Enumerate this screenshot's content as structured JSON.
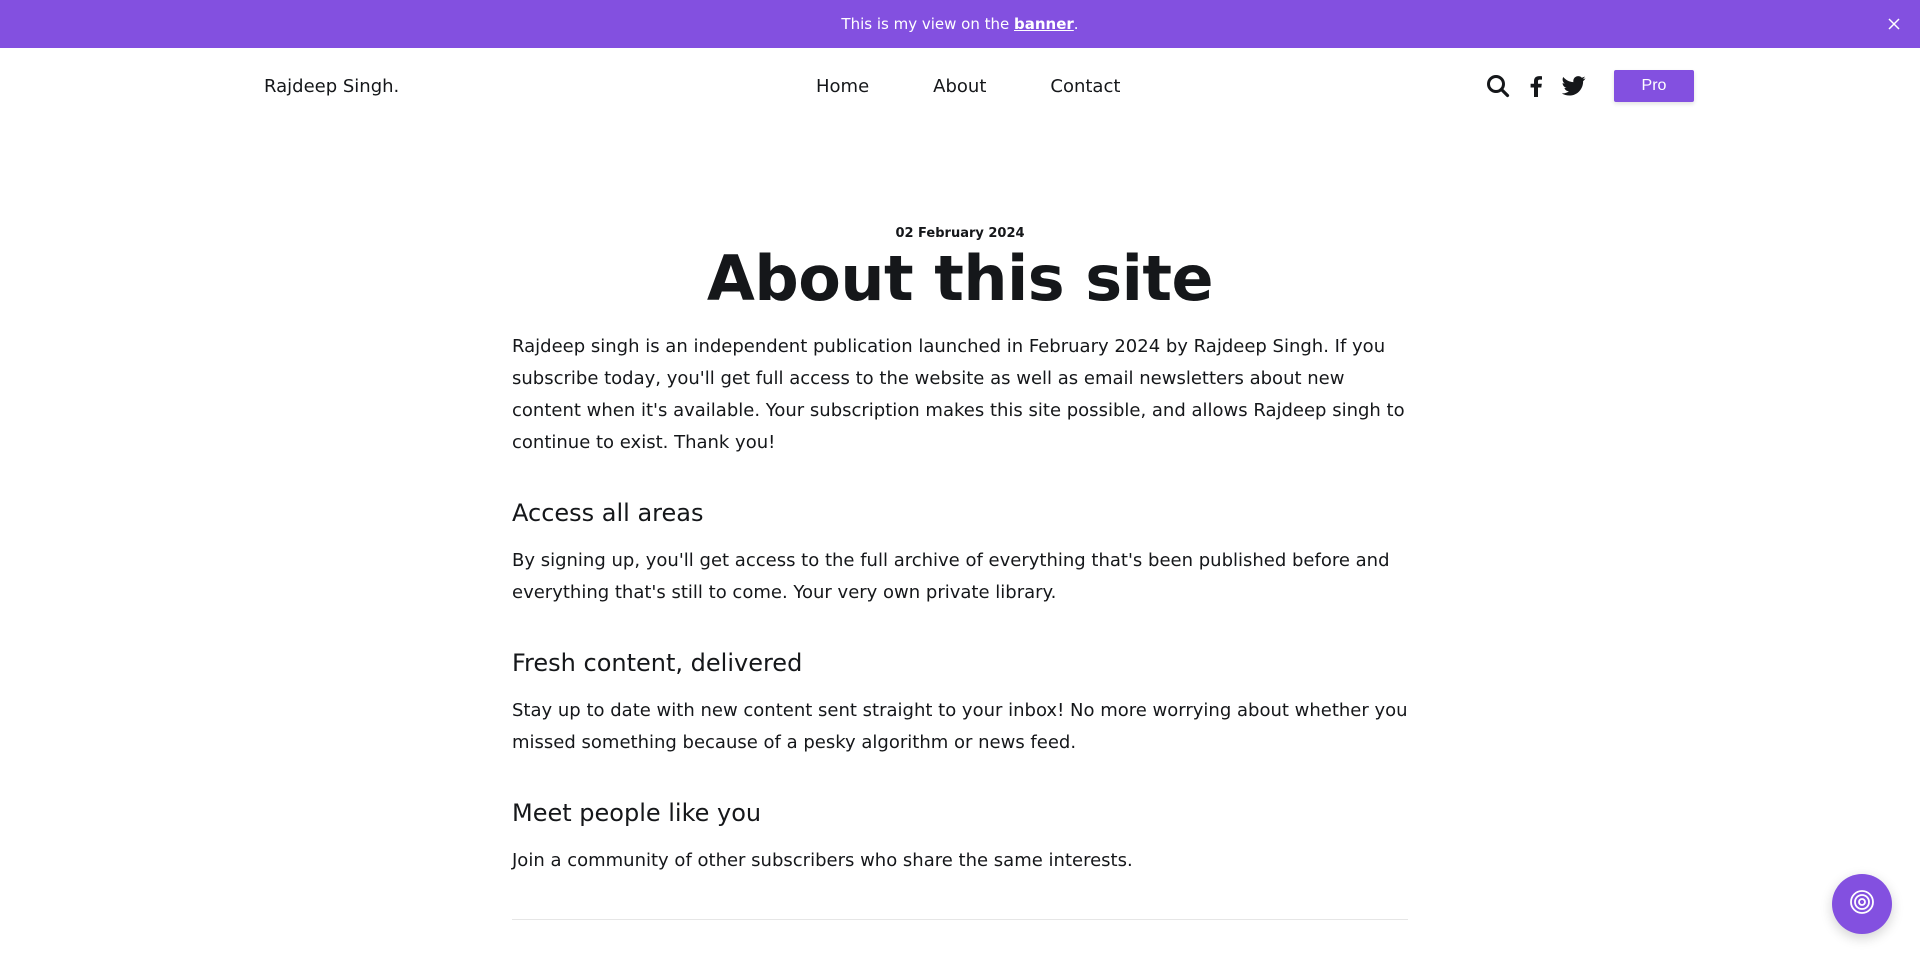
{
  "banner": {
    "text_before": "This is my view on the ",
    "link_text": "banner",
    "text_after": ".",
    "background": "#8350e0",
    "close_icon": "close-icon"
  },
  "header": {
    "logo": "Rajdeep Singh.",
    "nav": [
      {
        "label": "Home"
      },
      {
        "label": "About"
      },
      {
        "label": "Contact"
      }
    ],
    "icons": [
      "search-icon",
      "facebook-icon",
      "twitter-icon"
    ],
    "pro_label": "Pro",
    "accent": "#8350e0"
  },
  "article": {
    "date": "02 February 2024",
    "title": "About this site",
    "intro": "Rajdeep singh is an independent publication launched in February 2024 by Rajdeep Singh. If you subscribe today, you'll get full access to the website as well as email newsletters about new content when it's available. Your subscription makes this site possible, and allows Rajdeep singh to continue to exist. Thank you!",
    "sections": [
      {
        "heading": "Access all areas",
        "body": "By signing up, you'll get access to the full archive of everything that's been published before and everything that's still to come. Your very own private library."
      },
      {
        "heading": "Fresh content, delivered",
        "body": "Stay up to date with new content sent straight to your inbox! No more worrying about whether you missed something because of a pesky algorithm or news feed."
      },
      {
        "heading": "Meet people like you",
        "body": "Join a community of other subscribers who share the same interests."
      }
    ]
  },
  "portal_button": {
    "icon": "portal-icon"
  }
}
